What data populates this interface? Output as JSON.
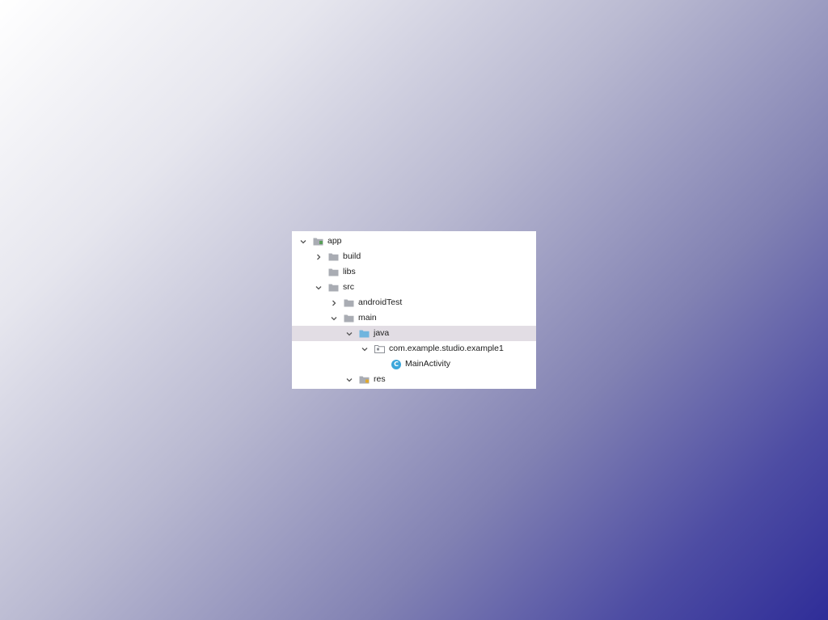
{
  "tree": {
    "nodes": [
      {
        "label": "app",
        "icon": "module-folder-icon",
        "arrow": "expanded",
        "depth": 0
      },
      {
        "label": "build",
        "icon": "folder-icon",
        "arrow": "collapsed",
        "depth": 1
      },
      {
        "label": "libs",
        "icon": "folder-icon",
        "arrow": "none",
        "depth": 1
      },
      {
        "label": "src",
        "icon": "folder-icon",
        "arrow": "expanded",
        "depth": 1
      },
      {
        "label": "androidTest",
        "icon": "folder-icon",
        "arrow": "collapsed",
        "depth": 2
      },
      {
        "label": "main",
        "icon": "folder-icon",
        "arrow": "expanded",
        "depth": 2
      },
      {
        "label": "java",
        "icon": "source-folder-icon",
        "arrow": "expanded",
        "depth": 3,
        "selected": true
      },
      {
        "label": "com.example.studio.example1",
        "icon": "package-icon",
        "arrow": "expanded",
        "depth": 4
      },
      {
        "label": "MainActivity",
        "icon": "class-icon",
        "class_letter": "C",
        "arrow": "none",
        "depth": 5
      },
      {
        "label": "res",
        "icon": "resource-folder-icon",
        "arrow": "expanded",
        "depth": 3
      }
    ]
  },
  "colors": {
    "gradient_start": "#ffffff",
    "gradient_end": "#2f2d98",
    "selection": "#e2dde4",
    "folder_gray": "#a9acb3",
    "source_folder_blue": "#6fb5de",
    "class_icon_blue": "#3ca7db"
  }
}
